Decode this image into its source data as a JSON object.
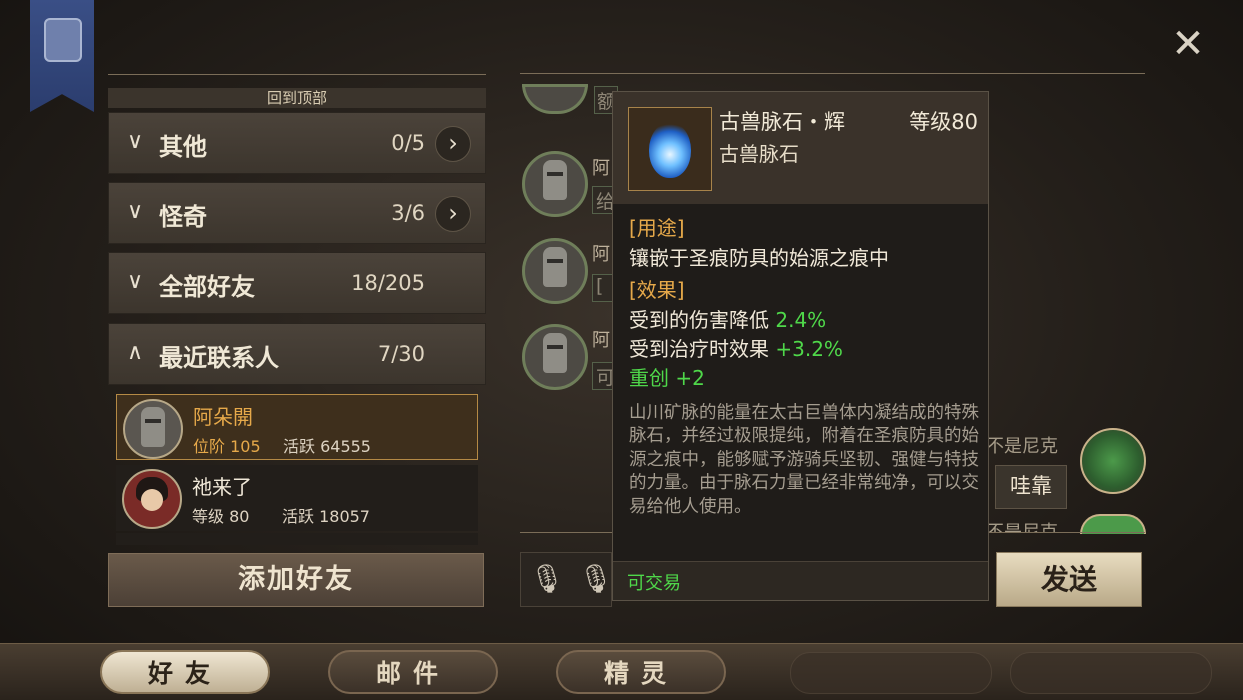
{
  "left_panel": {
    "back_to_top": "回到顶部",
    "groups": [
      {
        "name": "其他",
        "count": "0/5",
        "expanded": false,
        "has_arrow": true
      },
      {
        "name": "怪奇",
        "count": "3/6",
        "expanded": false,
        "has_arrow": true
      },
      {
        "name": "全部好友",
        "count": "18/205",
        "expanded": false,
        "has_arrow": false
      },
      {
        "name": "最近联系人",
        "count": "7/30",
        "expanded": true,
        "has_arrow": false
      }
    ],
    "contacts": [
      {
        "name": "阿朵開",
        "rank_label": "位阶 105",
        "activity": "活跃 64555",
        "selected": true
      },
      {
        "name": "祂来了",
        "rank_label": "等级 80",
        "activity": "活跃 18057",
        "selected": false
      }
    ],
    "add_friend": "添加好友"
  },
  "chat": {
    "sender_prefix": "阿",
    "partial_messages": [
      "额",
      "给",
      "[",
      "可"
    ],
    "right_user_name": "我不是尼克",
    "right_message": "哇靠",
    "send": "发送"
  },
  "tooltip": {
    "item_name": "古兽脉石・辉",
    "level": "等级80",
    "item_type": "古兽脉石",
    "usage_header": "[用途]",
    "usage_text": "镶嵌于圣痕防具的始源之痕中",
    "effect_header": "[效果]",
    "effects": [
      {
        "label": "受到的伤害降低 ",
        "value": "2.4%"
      },
      {
        "label": "受到治疗时效果 ",
        "value": "+3.2%"
      },
      {
        "label": "重创 ",
        "value": "+2"
      }
    ],
    "description": "山川矿脉的能量在太古巨兽体内凝结成的特殊脉石，并经过极限提纯，附着在圣痕防具的始源之痕中，能够赋予游骑兵坚韧、强健与特技的力量。由于脉石力量已经非常纯净，可以交易给他人使用。",
    "tradeable": "可交易"
  },
  "bottom_tabs": [
    {
      "label": "好友",
      "active": true
    },
    {
      "label": "邮件",
      "active": false
    },
    {
      "label": "精灵",
      "active": false
    }
  ],
  "colors": {
    "accent_orange": "#e6a94a",
    "stat_green": "#4fd84a",
    "selected_border": "#b58a45"
  }
}
